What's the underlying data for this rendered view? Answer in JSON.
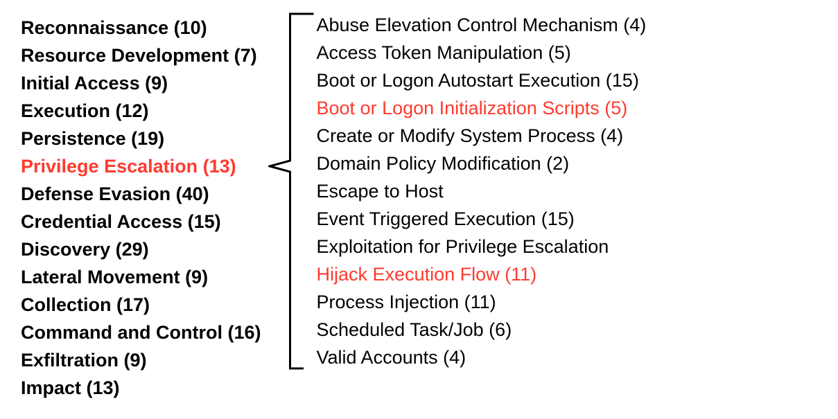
{
  "highlight_color": "#ff3a2f",
  "tactics": [
    {
      "label": "Reconnaissance",
      "count": 10,
      "highlight": false
    },
    {
      "label": "Resource Development",
      "count": 7,
      "highlight": false
    },
    {
      "label": "Initial Access",
      "count": 9,
      "highlight": false
    },
    {
      "label": "Execution",
      "count": 12,
      "highlight": false
    },
    {
      "label": "Persistence",
      "count": 19,
      "highlight": false
    },
    {
      "label": "Privilege Escalation",
      "count": 13,
      "highlight": true
    },
    {
      "label": "Defense Evasion",
      "count": 40,
      "highlight": false
    },
    {
      "label": "Credential Access",
      "count": 15,
      "highlight": false
    },
    {
      "label": "Discovery",
      "count": 29,
      "highlight": false
    },
    {
      "label": "Lateral Movement",
      "count": 9,
      "highlight": false
    },
    {
      "label": "Collection",
      "count": 17,
      "highlight": false
    },
    {
      "label": "Command and Control",
      "count": 16,
      "highlight": false
    },
    {
      "label": "Exfiltration",
      "count": 9,
      "highlight": false
    },
    {
      "label": "Impact",
      "count": 13,
      "highlight": false
    }
  ],
  "techniques": [
    {
      "label": "Abuse Elevation Control Mechanism",
      "count": 4,
      "highlight": false
    },
    {
      "label": "Access Token Manipulation",
      "count": 5,
      "highlight": false
    },
    {
      "label": "Boot or Logon Autostart Execution",
      "count": 15,
      "highlight": false
    },
    {
      "label": "Boot or Logon Initialization Scripts",
      "count": 5,
      "highlight": true
    },
    {
      "label": "Create or Modify System Process",
      "count": 4,
      "highlight": false
    },
    {
      "label": "Domain Policy Modification",
      "count": 2,
      "highlight": false
    },
    {
      "label": "Escape to Host",
      "count": null,
      "highlight": false
    },
    {
      "label": "Event Triggered Execution",
      "count": 15,
      "highlight": false
    },
    {
      "label": "Exploitation for Privilege Escalation",
      "count": null,
      "highlight": false
    },
    {
      "label": "Hijack Execution Flow",
      "count": 11,
      "highlight": true
    },
    {
      "label": "Process Injection",
      "count": 11,
      "highlight": false
    },
    {
      "label": "Scheduled Task/Job",
      "count": 6,
      "highlight": false
    },
    {
      "label": "Valid Accounts",
      "count": 4,
      "highlight": false
    }
  ]
}
